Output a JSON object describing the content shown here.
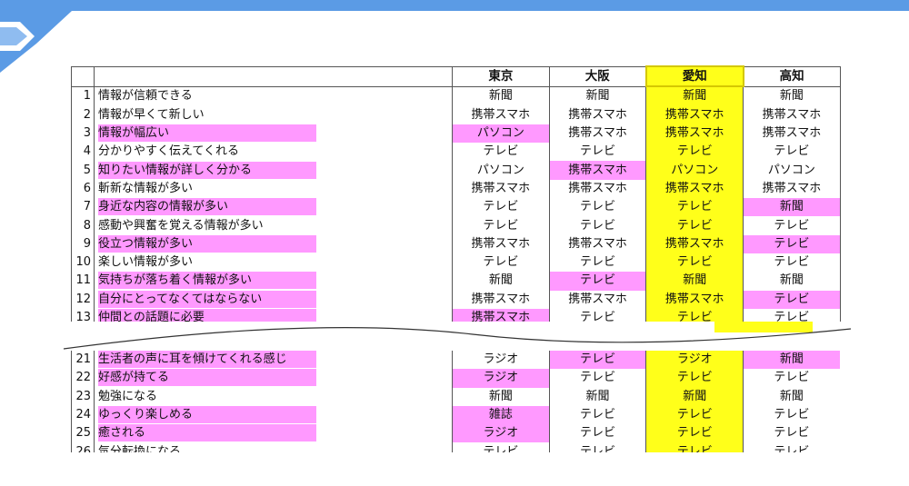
{
  "header": {
    "num": "",
    "question": "",
    "cities": [
      "東京",
      "大阪",
      "愛知",
      "高知"
    ]
  },
  "highlight_colors": {
    "pink": "#ff99ff",
    "yellow": "#ffff1a",
    "accent": "#5b9be5"
  },
  "rows_top": [
    {
      "n": "1",
      "q": "情報が信頼できる",
      "q_hl": false,
      "v": [
        "新聞",
        "新聞",
        "新聞",
        "新聞"
      ],
      "pink": [
        false,
        false,
        false,
        false
      ]
    },
    {
      "n": "2",
      "q": "情報が早くて新しい",
      "q_hl": false,
      "v": [
        "携帯スマホ",
        "携帯スマホ",
        "携帯スマホ",
        "携帯スマホ"
      ],
      "pink": [
        false,
        false,
        false,
        false
      ]
    },
    {
      "n": "3",
      "q": "情報が幅広い",
      "q_hl": true,
      "v": [
        "パソコン",
        "携帯スマホ",
        "携帯スマホ",
        "携帯スマホ"
      ],
      "pink": [
        true,
        false,
        false,
        false
      ]
    },
    {
      "n": "4",
      "q": "分かりやすく伝えてくれる",
      "q_hl": false,
      "v": [
        "テレビ",
        "テレビ",
        "テレビ",
        "テレビ"
      ],
      "pink": [
        false,
        false,
        false,
        false
      ]
    },
    {
      "n": "5",
      "q": "知りたい情報が詳しく分かる",
      "q_hl": true,
      "v": [
        "パソコン",
        "携帯スマホ",
        "パソコン",
        "パソコン"
      ],
      "pink": [
        false,
        true,
        false,
        false
      ]
    },
    {
      "n": "6",
      "q": "斬新な情報が多い",
      "q_hl": false,
      "v": [
        "携帯スマホ",
        "携帯スマホ",
        "携帯スマホ",
        "携帯スマホ"
      ],
      "pink": [
        false,
        false,
        false,
        false
      ]
    },
    {
      "n": "7",
      "q": "身近な内容の情報が多い",
      "q_hl": true,
      "v": [
        "テレビ",
        "テレビ",
        "テレビ",
        "新聞"
      ],
      "pink": [
        false,
        false,
        false,
        true
      ]
    },
    {
      "n": "8",
      "q": "感動や興奮を覚える情報が多い",
      "q_hl": false,
      "v": [
        "テレビ",
        "テレビ",
        "テレビ",
        "テレビ"
      ],
      "pink": [
        false,
        false,
        false,
        false
      ]
    },
    {
      "n": "9",
      "q": "役立つ情報が多い",
      "q_hl": true,
      "v": [
        "携帯スマホ",
        "携帯スマホ",
        "携帯スマホ",
        "テレビ"
      ],
      "pink": [
        false,
        false,
        false,
        true
      ]
    },
    {
      "n": "10",
      "q": "楽しい情報が多い",
      "q_hl": false,
      "v": [
        "テレビ",
        "テレビ",
        "テレビ",
        "テレビ"
      ],
      "pink": [
        false,
        false,
        false,
        false
      ]
    },
    {
      "n": "11",
      "q": "気持ちが落ち着く情報が多い",
      "q_hl": true,
      "v": [
        "新聞",
        "テレビ",
        "新聞",
        "新聞"
      ],
      "pink": [
        false,
        true,
        false,
        false
      ]
    },
    {
      "n": "12",
      "q": "自分にとってなくてはならない",
      "q_hl": true,
      "v": [
        "携帯スマホ",
        "携帯スマホ",
        "携帯スマホ",
        "テレビ"
      ],
      "pink": [
        false,
        false,
        false,
        true
      ]
    },
    {
      "n": "13",
      "q": "仲間との話題に必要",
      "q_hl": true,
      "v": [
        "携帯スマホ",
        "テレビ",
        "テレビ",
        "テレビ"
      ],
      "pink": [
        true,
        false,
        false,
        false
      ]
    }
  ],
  "rows_bottom": [
    {
      "n": "21",
      "q": "生活者の声に耳を傾けてくれる感じ",
      "q_hl": true,
      "v": [
        "ラジオ",
        "テレビ",
        "ラジオ",
        "新聞"
      ],
      "pink": [
        false,
        true,
        false,
        true
      ]
    },
    {
      "n": "22",
      "q": "好感が持てる",
      "q_hl": true,
      "v": [
        "ラジオ",
        "テレビ",
        "テレビ",
        "テレビ"
      ],
      "pink": [
        true,
        false,
        false,
        false
      ]
    },
    {
      "n": "23",
      "q": "勉強になる",
      "q_hl": false,
      "v": [
        "新聞",
        "新聞",
        "新聞",
        "新聞"
      ],
      "pink": [
        false,
        false,
        false,
        false
      ]
    },
    {
      "n": "24",
      "q": "ゆっくり楽しめる",
      "q_hl": true,
      "v": [
        "雑誌",
        "テレビ",
        "テレビ",
        "テレビ"
      ],
      "pink": [
        true,
        false,
        false,
        false
      ]
    },
    {
      "n": "25",
      "q": "癒される",
      "q_hl": true,
      "v": [
        "ラジオ",
        "テレビ",
        "テレビ",
        "テレビ"
      ],
      "pink": [
        true,
        false,
        false,
        false
      ]
    },
    {
      "n": "26",
      "q": "気分転換になる",
      "q_hl": false,
      "v": [
        "テレビ",
        "テレビ",
        "テレビ",
        "テレビ"
      ],
      "pink": [
        false,
        false,
        false,
        false
      ]
    }
  ]
}
